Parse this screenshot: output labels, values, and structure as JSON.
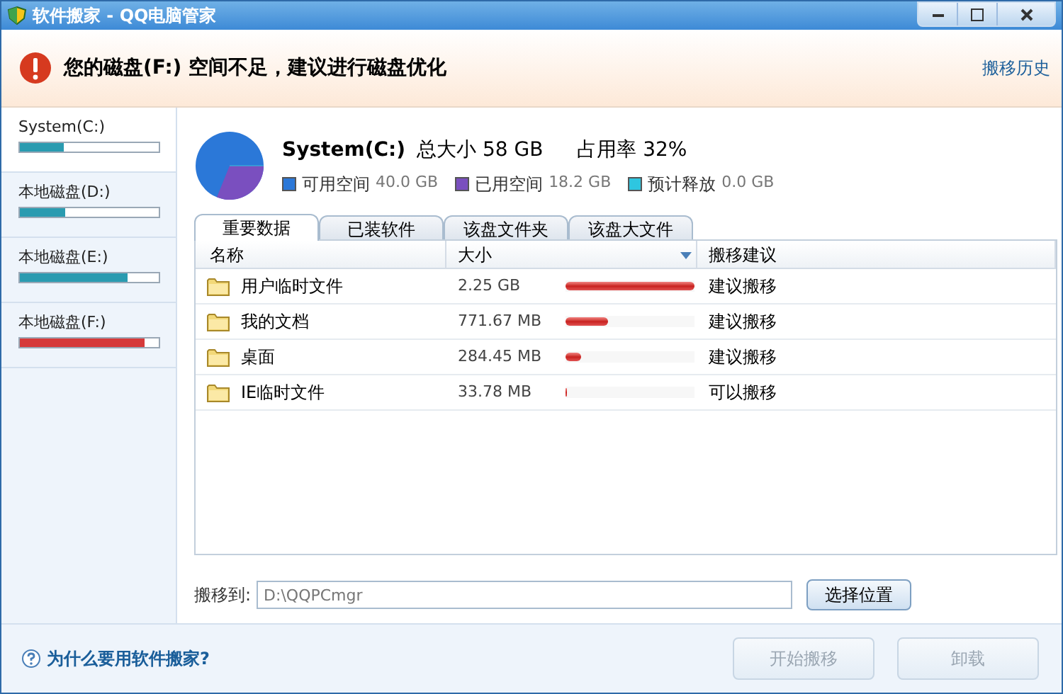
{
  "window": {
    "title": "软件搬家 - QQ电脑管家"
  },
  "alert": {
    "message": "您的磁盘(F:) 空间不足，建议进行磁盘优化",
    "link": "搬移历史"
  },
  "drives": [
    {
      "name": "System(C:)",
      "level": 0.32,
      "color": "#2a9bb0",
      "selected": true
    },
    {
      "name": "本地磁盘(D:)",
      "level": 0.33,
      "color": "#2a9bb0",
      "selected": false
    },
    {
      "name": "本地磁盘(E:)",
      "level": 0.78,
      "color": "#2a9bb0",
      "selected": false
    },
    {
      "name": "本地磁盘(F:)",
      "level": 0.9,
      "color": "#d63a3a",
      "selected": false
    }
  ],
  "summary": {
    "drive": "System(C:)",
    "total_label": "总大小",
    "total": "58 GB",
    "usage_label": "占用率",
    "usage": "32%",
    "legend": [
      {
        "label": "可用空间",
        "value": "40.0 GB",
        "color": "#2b78d8"
      },
      {
        "label": "已用空间",
        "value": "18.2 GB",
        "color": "#7a4fbf"
      },
      {
        "label": "预计释放",
        "value": "0.0 GB",
        "color": "#2ec6e0"
      }
    ]
  },
  "tabs": [
    {
      "label": "重要数据",
      "selected": true
    },
    {
      "label": "已装软件",
      "selected": false
    },
    {
      "label": "该盘文件夹",
      "selected": false
    },
    {
      "label": "该盘大文件",
      "selected": false
    }
  ],
  "table": {
    "columns": [
      "名称",
      "大小",
      "搬移建议"
    ],
    "rows": [
      {
        "name": "用户临时文件",
        "size": "2.25 GB",
        "level": 1.0,
        "advice": "建议搬移"
      },
      {
        "name": "我的文档",
        "size": "771.67 MB",
        "level": 0.33,
        "advice": "建议搬移"
      },
      {
        "name": "桌面",
        "size": "284.45 MB",
        "level": 0.12,
        "advice": "建议搬移"
      },
      {
        "name": "IE临时文件",
        "size": "33.78 MB",
        "level": 0.01,
        "advice": "可以搬移"
      }
    ]
  },
  "move_to": {
    "label": "搬移到:",
    "value": "D:\\QQPCmgr",
    "button": "选择位置"
  },
  "footer": {
    "help": "为什么要用软件搬家?",
    "buttons": [
      {
        "label": "开始搬移",
        "disabled": true
      },
      {
        "label": "卸载",
        "disabled": true
      }
    ]
  }
}
